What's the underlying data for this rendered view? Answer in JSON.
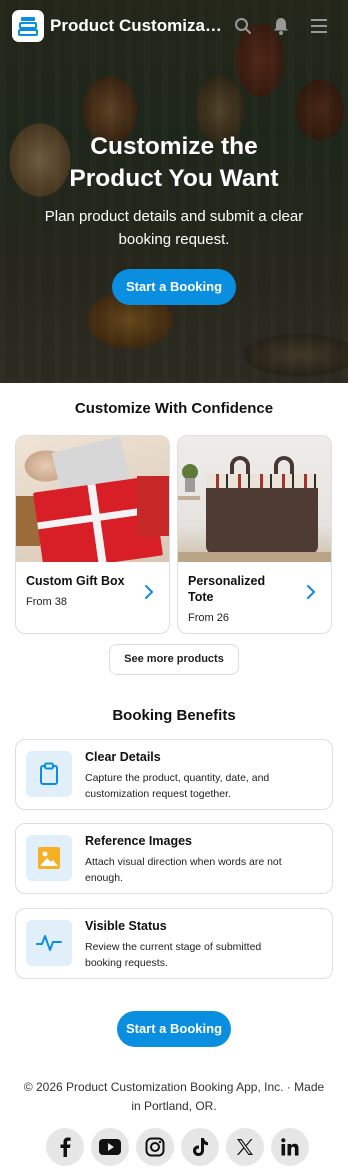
{
  "header": {
    "app_title": "Product Customizatio...",
    "icons": [
      "logo-icon",
      "search-icon",
      "notification-icon",
      "menu-icon"
    ]
  },
  "hero": {
    "title_line1": "Customize the",
    "title_line2": "Product You Want",
    "subtitle": "Plan product details and submit a clear booking request.",
    "button_label": "Start a Booking"
  },
  "confidence": {
    "title": "Customize With Confidence",
    "products": [
      {
        "name": "Custom Gift Box",
        "price": "From 38"
      },
      {
        "name": "Personalized Tote",
        "price": "From 26"
      }
    ],
    "see_more_label": "See more products"
  },
  "benefits": {
    "title": "Booking Benefits",
    "items": [
      {
        "title": "Clear Details",
        "desc": "Capture the product, quantity, date, and customization request together.",
        "icon": "clipboard-icon"
      },
      {
        "title": "Reference Images",
        "desc": "Attach visual direction when words are not enough.",
        "icon": "image-icon"
      },
      {
        "title": "Visible Status",
        "desc": "Review the current stage of submitted booking requests.",
        "icon": "activity-icon"
      }
    ]
  },
  "cta": {
    "button_label": "Start a Booking"
  },
  "footer": {
    "text": "© 2026 Product Customization Booking App, Inc. · Made in Portland, OR.",
    "socials": [
      "facebook-icon",
      "youtube-icon",
      "instagram-icon",
      "tiktok-icon",
      "x-icon",
      "linkedin-icon"
    ]
  },
  "colors": {
    "accent": "#0a8fe0",
    "icon_bg": "#e0eff9",
    "image_icon": "#f5b025"
  }
}
